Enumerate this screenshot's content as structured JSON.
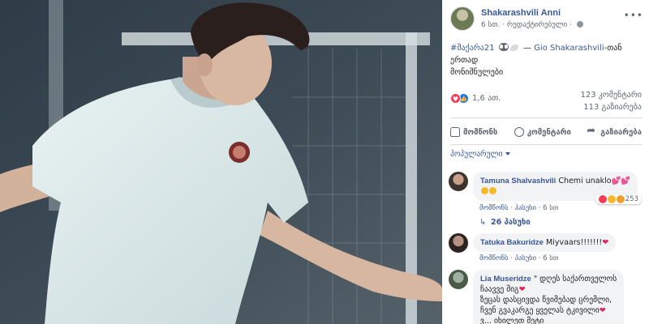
{
  "post": {
    "author": "Shakarashvili Anni",
    "time": "6 სთ.",
    "edited": "რედაქტირებული",
    "globe_icon": "globe-icon",
    "more_icon": "more-options-icon",
    "hashtag": "#შაქარა21",
    "tag_separator": "—",
    "tagged_user": "Gio Shakarashvili",
    "text_suffix": "-თან ერთად",
    "text_line2": "მონიშნულები"
  },
  "stats": {
    "reactions_count": "1,6 ათ.",
    "comments_count": "123 კომენტარი",
    "shares_count": "113 გაზიარება"
  },
  "actions": {
    "like": "მომწონს",
    "comment": "კომენტარი",
    "share": "გაზიარება"
  },
  "sort": {
    "label": "პოპულარული"
  },
  "comments": [
    {
      "author": "Tamuna Shalvashvili",
      "text": "Chemi unaklo",
      "react_count": "253",
      "like": "მომწონს",
      "reply": "პასუხი",
      "time": "6 სთ",
      "replies": "26 პასუხი"
    },
    {
      "author": "Tatuka Bakuridze",
      "text": "Miyvaars!!!!!!!",
      "like": "მომწონს",
      "reply": "პასუხი",
      "time": "6 სთ"
    },
    {
      "author": "Lia Museridze",
      "text_line1": "\" დღეს საქართველოს",
      "text_line2": "ჩაავვე შიგ",
      "text_line3": "ზეცას დასცივდა წვიმებად ცრემლი,",
      "text_line4": "ჩვენ გვაკარგე ყველას ტკივილი",
      "text_line5": "ვ... იხილეთ მეტი"
    }
  ],
  "colors": {
    "link": "#385898",
    "meta": "#606770",
    "bubble": "#f2f3f5",
    "love": "#f33e58",
    "like": "#1877f2"
  }
}
